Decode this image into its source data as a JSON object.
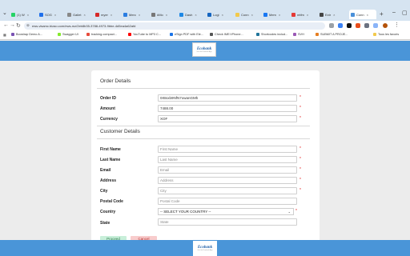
{
  "browser": {
    "tabs": [
      {
        "label": "(1) W",
        "color": "#25d366"
      },
      {
        "label": "SOG",
        "color": "#1f6feb"
      },
      {
        "label": "Gallet",
        "color": "#888888"
      },
      {
        "label": "myer",
        "color": "#d62828"
      },
      {
        "label": "Merc",
        "color": "#2a7de1"
      },
      {
        "label": "#Mo",
        "color": "#777777"
      },
      {
        "label": "Dash",
        "color": "#1e88e5"
      },
      {
        "label": "Logi",
        "color": "#1565c0"
      },
      {
        "label": "Conn",
        "color": "#f2c94c"
      },
      {
        "label": "Mem",
        "color": "#1877f2"
      },
      {
        "label": "mtfm",
        "color": "#e53935"
      },
      {
        "label": "Extr",
        "color": "#444444"
      },
      {
        "label": "Conn",
        "color": "#4a90d9"
      }
    ],
    "url": "ews-visamc.bizao.com/ews-mz/2eb8b35-3788-4973-9bbe-4d5ea4a62afd",
    "bookmarks": [
      {
        "label": "Boostrap Demo A...",
        "color": "#7952b3"
      },
      {
        "label": "Swagger UI",
        "color": "#85ea2d"
      },
      {
        "label": "tracking.compact...",
        "color": "#e74c3c"
      },
      {
        "label": "YouTube to MP3 C...",
        "color": "#ff0000"
      },
      {
        "label": "eSign PDF with Ele...",
        "color": "#1a73e8"
      },
      {
        "label": "Check IMEI iPhone...",
        "color": "#555555"
      },
      {
        "label": "Shortcodes includ...",
        "color": "#21759b"
      },
      {
        "label": "SVH",
        "color": "#9b59b6"
      },
      {
        "label": "SUBMIT A PROJE...",
        "color": "#e67e22"
      }
    ],
    "bookmarks_all": "Tous les favoris"
  },
  "logo": {
    "name": "Ecobank",
    "sub": "Get the Ecobank App"
  },
  "order_details": {
    "title": "Order Details",
    "fields": [
      {
        "label": "Order ID",
        "value": "0rBsxb9NfN7owanGMh",
        "required": "*"
      },
      {
        "label": "Amount",
        "value": "7488.00",
        "required": "*"
      },
      {
        "label": "Currency",
        "value": "XOF",
        "required": "*"
      }
    ]
  },
  "customer_details": {
    "title": "Customer Details",
    "fields": [
      {
        "label": "First Name",
        "placeholder": "First Name",
        "required": "*"
      },
      {
        "label": "Last Name",
        "placeholder": "Last Name",
        "required": "*"
      },
      {
        "label": "Email",
        "placeholder": "Email",
        "required": "*"
      },
      {
        "label": "Address",
        "placeholder": "Address",
        "required": "*"
      },
      {
        "label": "City",
        "placeholder": "City",
        "required": "*"
      },
      {
        "label": "Postal Code",
        "placeholder": "Postal Code",
        "required": ""
      }
    ],
    "country": {
      "label": "Country",
      "selected": "-- SELECT YOUR COUNTRY --",
      "required": "*"
    },
    "state": {
      "label": "State",
      "placeholder": "State"
    }
  },
  "buttons": {
    "proceed": "Proceed",
    "cancel": "Cancel"
  },
  "colors": {
    "header": "#4a95d8",
    "proceed": "#c8efd9",
    "cancel": "#f8cccc",
    "required": "#e02020"
  }
}
